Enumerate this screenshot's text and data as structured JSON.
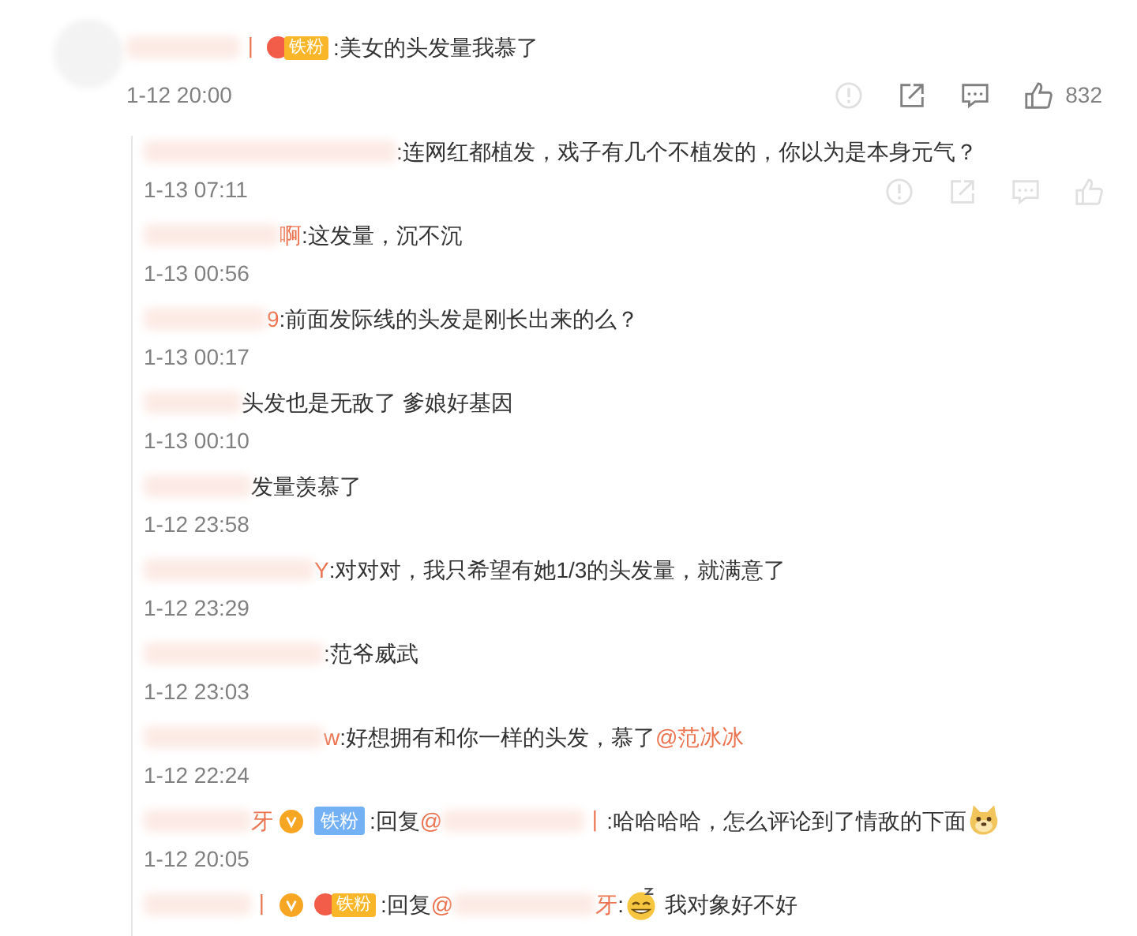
{
  "comment": {
    "segments": [
      {
        "kind": "blur"
      },
      {
        "kind": "name",
        "text": "丨"
      },
      {
        "kind": "crown-badge",
        "text": "铁粉"
      },
      {
        "kind": "text",
        "text": ":美女的头发量我慕了"
      }
    ],
    "time": "1-12 20:00",
    "actions": [
      {
        "kind": "report",
        "dimmed": true
      },
      {
        "kind": "share",
        "dimmed": false
      },
      {
        "kind": "comment",
        "dimmed": false
      },
      {
        "kind": "like",
        "dimmed": false,
        "count": "832"
      }
    ]
  },
  "replies": [
    {
      "segments": [
        {
          "kind": "blur"
        },
        {
          "kind": "text",
          "text": ":连网红都植发，戏子有几个不植发的，你以为是本身元气？"
        }
      ],
      "time": "1-13 07:11",
      "actions": [
        {
          "kind": "report",
          "dimmed": true
        },
        {
          "kind": "share",
          "dimmed": true
        },
        {
          "kind": "comment",
          "dimmed": true
        },
        {
          "kind": "like",
          "dimmed": true
        }
      ]
    },
    {
      "segments": [
        {
          "kind": "blur"
        },
        {
          "kind": "name",
          "text": "啊"
        },
        {
          "kind": "text",
          "text": ":这发量，沉不沉"
        }
      ],
      "time": "1-13 00:56"
    },
    {
      "segments": [
        {
          "kind": "blur"
        },
        {
          "kind": "name",
          "text": "9"
        },
        {
          "kind": "text",
          "text": ":前面发际线的头发是刚长出来的么？"
        }
      ],
      "time": "1-13 00:17"
    },
    {
      "segments": [
        {
          "kind": "blur"
        },
        {
          "kind": "text",
          "text": "头发也是无敌了 爹娘好基因"
        }
      ],
      "time": "1-13 00:10"
    },
    {
      "segments": [
        {
          "kind": "blur"
        },
        {
          "kind": "text",
          "text": "发量羡慕了"
        }
      ],
      "time": "1-12 23:58"
    },
    {
      "segments": [
        {
          "kind": "blur"
        },
        {
          "kind": "name",
          "text": "Y"
        },
        {
          "kind": "text",
          "text": ":对对对，我只希望有她1/3的头发量，就满意了"
        }
      ],
      "time": "1-12 23:29"
    },
    {
      "segments": [
        {
          "kind": "blur"
        },
        {
          "kind": "text",
          "text": ":范爷威武"
        }
      ],
      "time": "1-12 23:03"
    },
    {
      "segments": [
        {
          "kind": "blur"
        },
        {
          "kind": "name",
          "text": "w"
        },
        {
          "kind": "text",
          "text": ":好想拥有和你一样的头发，慕了"
        },
        {
          "kind": "mention",
          "text": "@范冰冰"
        }
      ],
      "time": "1-12 22:24"
    },
    {
      "segments": [
        {
          "kind": "blur"
        },
        {
          "kind": "name",
          "text": "牙"
        },
        {
          "kind": "verified"
        },
        {
          "kind": "blue-badge",
          "text": "铁粉"
        },
        {
          "kind": "text",
          "text": ":回复"
        },
        {
          "kind": "mention",
          "text": "@"
        },
        {
          "kind": "blur"
        },
        {
          "kind": "mention",
          "text": "丨"
        },
        {
          "kind": "text",
          "text": ":哈哈哈哈，怎么评论到了情敌的下面"
        },
        {
          "kind": "doge"
        }
      ],
      "time": "1-12 20:05"
    },
    {
      "segments": [
        {
          "kind": "blur"
        },
        {
          "kind": "name",
          "text": "丨"
        },
        {
          "kind": "verified"
        },
        {
          "kind": "crown-badge",
          "text": "铁粉"
        },
        {
          "kind": "text",
          "text": ":回复"
        },
        {
          "kind": "mention",
          "text": "@"
        },
        {
          "kind": "blur"
        },
        {
          "kind": "mention",
          "text": "牙"
        },
        {
          "kind": "text",
          "text": ":"
        },
        {
          "kind": "grin"
        },
        {
          "kind": "text",
          "text": " 我对象好不好"
        }
      ]
    }
  ]
}
